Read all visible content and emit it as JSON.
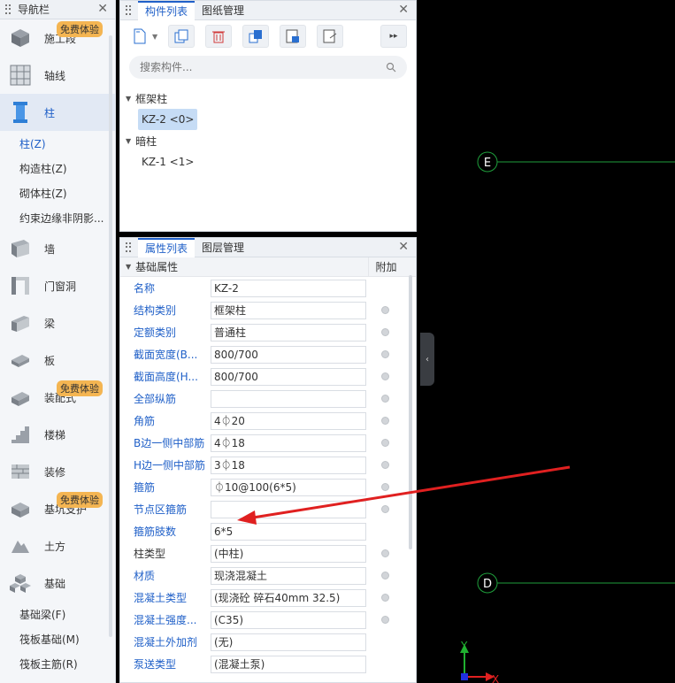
{
  "nav": {
    "title": "导航栏",
    "categories": [
      {
        "label": "施工段",
        "icon": "construction-block-icon",
        "badge": "免费体验"
      },
      {
        "label": "轴线",
        "icon": "grid-axis-icon"
      },
      {
        "label": "柱",
        "icon": "column-icon"
      },
      {
        "label": "墙",
        "icon": "wall-icon"
      },
      {
        "label": "门窗洞",
        "icon": "door-window-icon"
      },
      {
        "label": "梁",
        "icon": "beam-icon"
      },
      {
        "label": "板",
        "icon": "slab-icon"
      },
      {
        "label": "装配式",
        "icon": "prefab-icon",
        "badge": "免费体验"
      },
      {
        "label": "楼梯",
        "icon": "stairs-icon"
      },
      {
        "label": "装修",
        "icon": "decoration-icon"
      },
      {
        "label": "基坑支护",
        "icon": "foundation-pit-icon",
        "badge": "免费体验"
      },
      {
        "label": "土方",
        "icon": "earthwork-icon"
      },
      {
        "label": "基础",
        "icon": "foundation-icon"
      }
    ],
    "column_subitems": [
      "柱(Z)",
      "构造柱(Z)",
      "砌体柱(Z)",
      "约束边缘非阴影..."
    ],
    "foundation_subitems": [
      "基础梁(F)",
      "筏板基础(M)",
      "筏板主筋(R)"
    ]
  },
  "component_panel": {
    "tabs": [
      "构件列表",
      "图纸管理"
    ],
    "search_placeholder": "搜索构件...",
    "groups": [
      {
        "name": "框架柱",
        "items": [
          "KZ-2 <0>"
        ]
      },
      {
        "name": "暗柱",
        "items": [
          "KZ-1 <1>"
        ]
      }
    ]
  },
  "property_panel": {
    "tabs": [
      "属性列表",
      "图层管理"
    ],
    "header": {
      "section": "基础属性",
      "extra": "附加"
    },
    "rows": [
      {
        "name": "名称",
        "value": "KZ-2",
        "check": false,
        "blue": true
      },
      {
        "name": "结构类别",
        "value": "框架柱",
        "check": true,
        "blue": true
      },
      {
        "name": "定额类别",
        "value": "普通柱",
        "check": true,
        "blue": true
      },
      {
        "name": "截面宽度(B...",
        "value": "800/700",
        "check": true,
        "blue": true
      },
      {
        "name": "截面高度(H...",
        "value": "800/700",
        "check": true,
        "blue": true
      },
      {
        "name": "全部纵筋",
        "value": "",
        "check": true,
        "blue": true
      },
      {
        "name": "角筋",
        "value": "4⏀20",
        "check": true,
        "blue": true
      },
      {
        "name": "B边一侧中部筋",
        "value": "4⏀18",
        "check": true,
        "blue": true
      },
      {
        "name": "H边一侧中部筋",
        "value": "3⏀18",
        "check": true,
        "blue": true
      },
      {
        "name": "箍筋",
        "value": "⏀10@100(6*5)",
        "check": true,
        "blue": true
      },
      {
        "name": "节点区箍筋",
        "value": "",
        "check": true,
        "blue": true
      },
      {
        "name": "箍筋肢数",
        "value": "6*5",
        "check": false,
        "blue": true
      },
      {
        "name": "柱类型",
        "value": "(中柱)",
        "check": true,
        "blue": false
      },
      {
        "name": "材质",
        "value": "现浇混凝土",
        "check": true,
        "blue": true
      },
      {
        "name": "混凝土类型",
        "value": "(现浇砼 碎石40mm 32.5)",
        "check": true,
        "blue": true
      },
      {
        "name": "混凝土强度...",
        "value": "(C35)",
        "check": true,
        "blue": true
      },
      {
        "name": "混凝土外加剂",
        "value": "(无)",
        "check": false,
        "blue": true
      },
      {
        "name": "泵送类型",
        "value": "(混凝土泵)",
        "check": false,
        "blue": true
      }
    ]
  },
  "canvas": {
    "axis_labels": [
      "E",
      "D"
    ],
    "coord_labels": {
      "x": "X",
      "y": "Y"
    }
  },
  "colors": {
    "accent": "#2060c8",
    "badge": "#f4b552",
    "canvas_bg": "#000000",
    "axis_line": "#1f9e3c",
    "arrow": "#e02020"
  }
}
